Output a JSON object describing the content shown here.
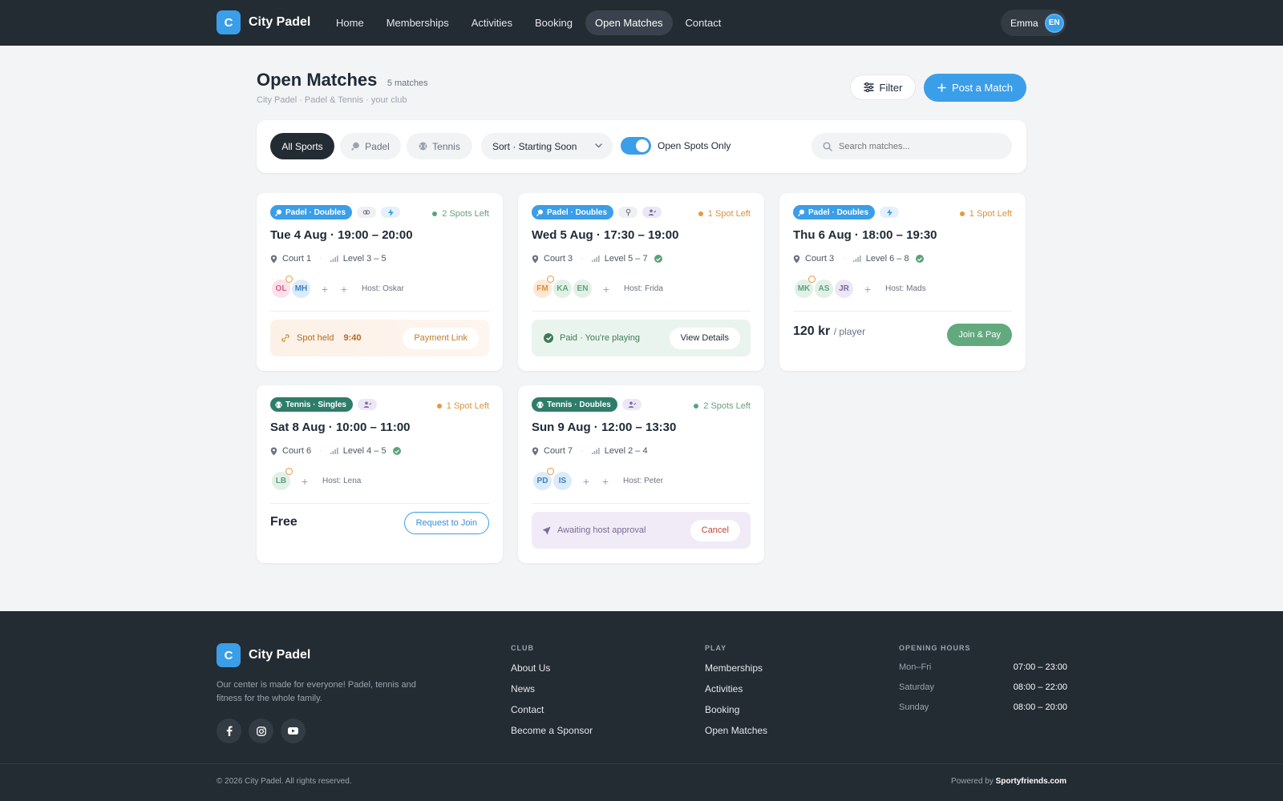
{
  "nav": {
    "brand_letter": "C",
    "brand": "City Padel",
    "links": [
      "Home",
      "Memberships",
      "Activities",
      "Booking",
      "Open Matches",
      "Contact"
    ],
    "active": "Open Matches",
    "user_name": "Emma",
    "user_badge": "EN"
  },
  "header": {
    "title": "Open Matches",
    "count": "5 matches",
    "subtitle": "City Padel · Padel & Tennis · your club",
    "filter_label": "Filter",
    "post_label": "Post a Match"
  },
  "filters": {
    "all": "All Sports",
    "padel": "Padel",
    "tennis": "Tennis",
    "sort": "Sort · Starting Soon",
    "open_spots_label": "Open Spots Only",
    "open_spots_on": true,
    "search_placeholder": "Search matches..."
  },
  "cards": [
    {
      "sport": "Padel · Doubles",
      "spots": "2 Spots Left",
      "title": "Tue 4 Aug · 19:00 – 20:00",
      "court": "Court 1",
      "level": "Level 3 – 5",
      "players": [
        "OL",
        "MH"
      ],
      "host": "Host: Oskar",
      "status_text": "Spot held",
      "timer": "9:40",
      "action": "Payment Link"
    },
    {
      "sport": "Padel · Doubles",
      "spots": "1 Spot Left",
      "title": "Wed 5 Aug · 17:30 – 19:00",
      "court": "Court 3",
      "level": "Level 5 – 7",
      "players": [
        "FM",
        "KA",
        "EN"
      ],
      "host": "Host: Frida",
      "status_text": "Paid · You're playing",
      "action": "View Details"
    },
    {
      "sport": "Padel · Doubles",
      "spots": "1 Spot Left",
      "title": "Thu 6 Aug · 18:00 – 19:30",
      "court": "Court 3",
      "level": "Level 6 – 8",
      "players": [
        "MK",
        "AS",
        "JR"
      ],
      "host": "Host: Mads",
      "price": "120 kr",
      "price_unit": "/ player",
      "action": "Join & Pay"
    },
    {
      "sport": "Tennis · Singles",
      "spots": "1 Spot Left",
      "title": "Sat 8 Aug · 10:00 – 11:00",
      "court": "Court 6",
      "level": "Level 4 – 5",
      "players": [
        "LB"
      ],
      "host": "Host: Lena",
      "price": "Free",
      "action": "Request to Join"
    },
    {
      "sport": "Tennis · Doubles",
      "spots": "2 Spots Left",
      "title": "Sun 9 Aug · 12:00 – 13:30",
      "court": "Court 7",
      "level": "Level 2 – 4",
      "players": [
        "PD",
        "IS"
      ],
      "host": "Host: Peter",
      "status_text": "Awaiting host approval",
      "action": "Cancel"
    }
  ],
  "footer": {
    "brand": "City Padel",
    "desc": "Our center is made for everyone! Padel, tennis and fitness for the whole family.",
    "club_h": "CLUB",
    "club": [
      "About Us",
      "News",
      "Contact",
      "Become a Sponsor"
    ],
    "play_h": "PLAY",
    "play": [
      "Memberships",
      "Activities",
      "Booking",
      "Open Matches"
    ],
    "hours_h": "OPENING HOURS",
    "hours": [
      {
        "day": "Mon–Fri",
        "time": "07:00 – 23:00"
      },
      {
        "day": "Saturday",
        "time": "08:00 – 22:00"
      },
      {
        "day": "Sunday",
        "time": "08:00 – 20:00"
      }
    ],
    "copyright": "© 2026 City Padel. All rights reserved.",
    "powered_prefix": "Powered by",
    "powered_brand": "Sportyfriends.com"
  },
  "colors": {
    "accent": "#3b9ee8",
    "dark": "#232b33",
    "green": "#63a97e",
    "orange": "#e59a3f"
  }
}
